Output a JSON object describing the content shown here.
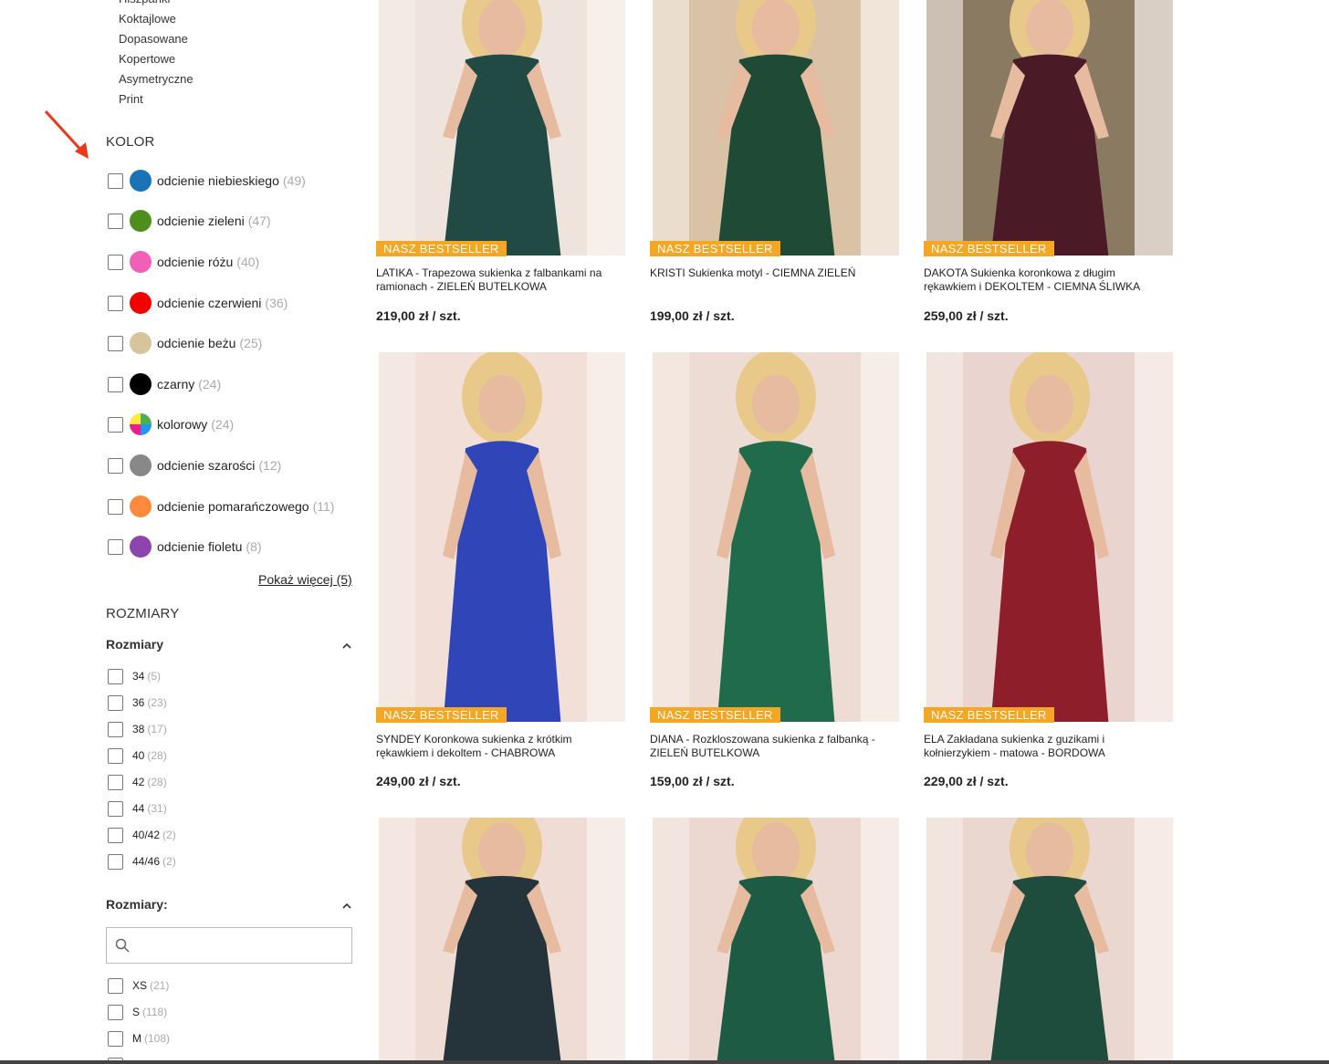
{
  "sidebar": {
    "styles": [
      "Hiszpanki",
      "Koktajlowe",
      "Dopasowane",
      "Kopertowe",
      "Asymetryczne",
      "Print"
    ],
    "kolor_title": "KOLOR",
    "colors": [
      {
        "label": "odcienie niebieskiego",
        "count": "(49)",
        "color": "#1a73b5"
      },
      {
        "label": "odcienie zieleni",
        "count": "(47)",
        "color": "#4c8f1c"
      },
      {
        "label": "odcienie różu",
        "count": "(40)",
        "color": "#f060b8"
      },
      {
        "label": "odcienie czerwieni",
        "count": "(36)",
        "color": "#f20000"
      },
      {
        "label": "odcienie beżu",
        "count": "(25)",
        "color": "#d6c49a"
      },
      {
        "label": "czarny",
        "count": "(24)",
        "color": "#000000"
      },
      {
        "label": "kolorowy",
        "count": "(24)",
        "color": "multi"
      },
      {
        "label": "odcienie szarości",
        "count": "(12)",
        "color": "#888888"
      },
      {
        "label": "odcienie pomarańczowego",
        "count": "(11)",
        "color": "#ff8a3d"
      },
      {
        "label": "odcienie fioletu",
        "count": "(8)",
        "color": "#8e44ad"
      }
    ],
    "show_more": "Pokaż więcej (5)",
    "rozmiary_title": "ROZMIARY",
    "rozmiary_sub": "Rozmiary",
    "sizes": [
      {
        "label": "34",
        "count": "(5)"
      },
      {
        "label": "36",
        "count": "(23)"
      },
      {
        "label": "38",
        "count": "(17)"
      },
      {
        "label": "40",
        "count": "(28)"
      },
      {
        "label": "42",
        "count": "(28)"
      },
      {
        "label": "44",
        "count": "(31)"
      },
      {
        "label": "40/42",
        "count": "(2)"
      },
      {
        "label": "44/46",
        "count": "(2)"
      }
    ],
    "rozmiary2_sub": "Rozmiary:",
    "search_placeholder": "",
    "letter_sizes": [
      {
        "label": "XS",
        "count": "(21)"
      },
      {
        "label": "S",
        "count": "(118)"
      },
      {
        "label": "M",
        "count": "(108)"
      }
    ]
  },
  "products": [
    {
      "badge": "NASZ BESTSELLER",
      "name": "LATIKA - Trapezowa sukienka z falbankami na ramionach - ZIELEŃ BUTELKOWA",
      "price": "219,00 zł / szt.",
      "dress": "#214a45",
      "bg": "#efe3dd"
    },
    {
      "badge": "NASZ BESTSELLER",
      "name": "KRISTI Sukienka motyl - CIEMNA ZIELEŃ",
      "price": "199,00 zł / szt.",
      "dress": "#1f4a36",
      "bg": "#d9c2a6"
    },
    {
      "badge": "NASZ BESTSELLER",
      "name": "DAKOTA Sukienka koronkowa z długim rękawkiem i DEKOLTEM - CIEMNA ŚLIWKA",
      "price": "259,00 zł / szt.",
      "dress": "#4a1b26",
      "bg": "#8a7a62"
    },
    {
      "badge": "NASZ BESTSELLER",
      "name": "SYNDEY Koronkowa sukienka z krótkim rękawkiem i dekoltem - CHABROWA",
      "price": "249,00 zł / szt.",
      "dress": "#2f45b8",
      "bg": "#f1dfd8"
    },
    {
      "badge": "NASZ BESTSELLER",
      "name": "DIANA - Rozkloszowana sukienka z falbanką - ZIELEŃ BUTELKOWA",
      "price": "159,00 zł / szt.",
      "dress": "#1f6b4c",
      "bg": "#eddcd3"
    },
    {
      "badge": "NASZ BESTSELLER",
      "name": "ELA Zakładana sukienka z guzikami i kołnierzykiem - matowa - BORDOWA",
      "price": "229,00 zł / szt.",
      "dress": "#8e1f2a",
      "bg": "#ead4cf"
    },
    {
      "badge": "",
      "name": "",
      "price": "",
      "dress": "#25333a",
      "bg": "#efdcd5"
    },
    {
      "badge": "",
      "name": "",
      "price": "",
      "dress": "#1d5b44",
      "bg": "#ecd8d0"
    },
    {
      "badge": "",
      "name": "",
      "price": "",
      "dress": "#1e4d3e",
      "bg": "#ead7d0"
    }
  ]
}
